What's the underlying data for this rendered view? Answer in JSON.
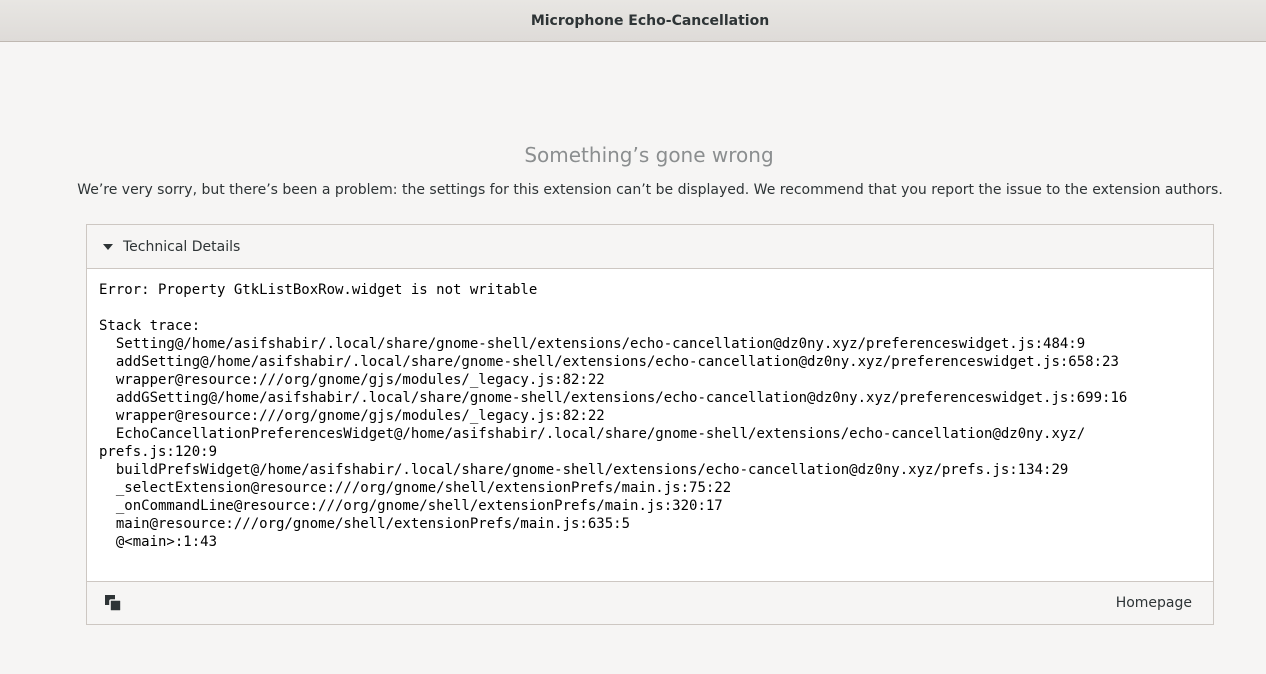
{
  "window": {
    "title": "Microphone Echo-Cancellation"
  },
  "error_page": {
    "heading": "Something’s gone wrong",
    "description": "We’re very sorry, but there’s been a problem: the settings for this extension can’t be displayed. We recommend that you report the issue to the extension authors."
  },
  "details": {
    "label": "Technical Details",
    "expanded": true,
    "trace": "Error: Property GtkListBoxRow.widget is not writable\n\nStack trace:\n  Setting@/home/asifshabir/.local/share/gnome-shell/extensions/echo-cancellation@dz0ny.xyz/preferenceswidget.js:484:9\n  addSetting@/home/asifshabir/.local/share/gnome-shell/extensions/echo-cancellation@dz0ny.xyz/preferenceswidget.js:658:23\n  wrapper@resource:///org/gnome/gjs/modules/_legacy.js:82:22\n  addGSetting@/home/asifshabir/.local/share/gnome-shell/extensions/echo-cancellation@dz0ny.xyz/preferenceswidget.js:699:16\n  wrapper@resource:///org/gnome/gjs/modules/_legacy.js:82:22\n  EchoCancellationPreferencesWidget@/home/asifshabir/.local/share/gnome-shell/extensions/echo-cancellation@dz0ny.xyz/\nprefs.js:120:9\n  buildPrefsWidget@/home/asifshabir/.local/share/gnome-shell/extensions/echo-cancellation@dz0ny.xyz/prefs.js:134:29\n  _selectExtension@resource:///org/gnome/shell/extensionPrefs/main.js:75:22\n  _onCommandLine@resource:///org/gnome/shell/extensionPrefs/main.js:320:17\n  main@resource:///org/gnome/shell/extensionPrefs/main.js:635:5\n  @<main>:1:43",
    "copy_icon": "edit-copy-icon",
    "homepage_label": "Homepage"
  }
}
